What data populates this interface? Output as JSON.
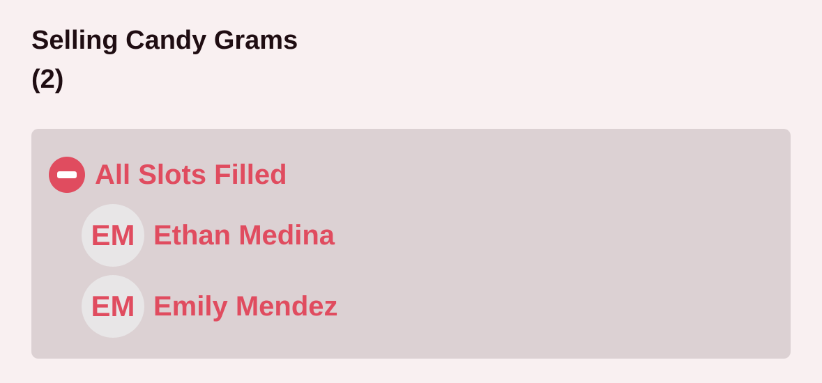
{
  "header": {
    "title": "Selling Candy Grams",
    "count": "(2)"
  },
  "slot": {
    "status": "All Slots Filled",
    "status_icon": "minus-circle-icon",
    "accent_color": "#e04c5f",
    "people": [
      {
        "initials": "EM",
        "name": "Ethan Medina"
      },
      {
        "initials": "EM",
        "name": "Emily Mendez"
      }
    ]
  }
}
